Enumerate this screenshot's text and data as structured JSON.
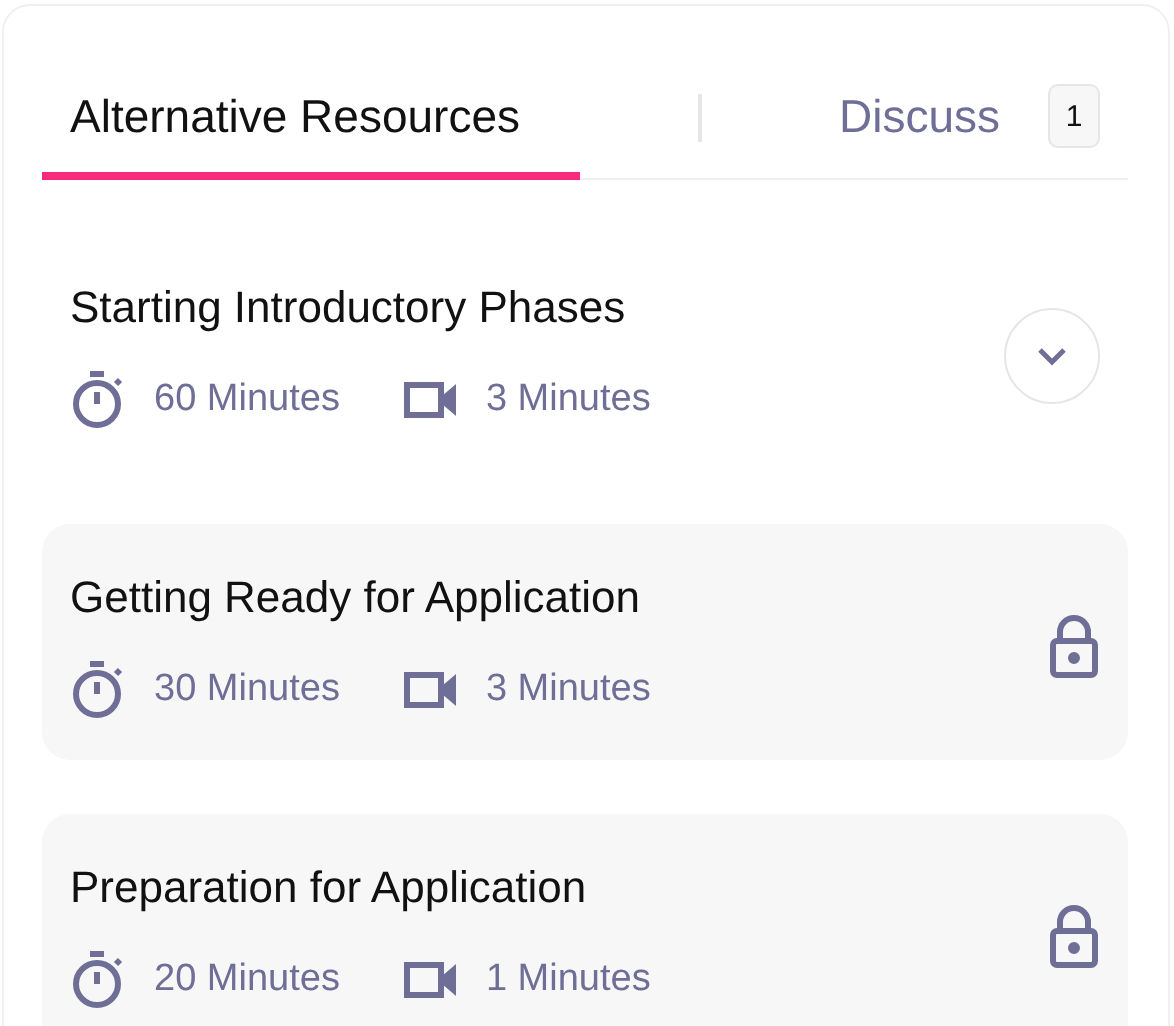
{
  "tabs": [
    {
      "label": "Alternative Resources",
      "selected": true
    },
    {
      "label": "Discuss",
      "selected": false,
      "badge": "1"
    }
  ],
  "lessons": [
    {
      "title": "Starting Introductory Phases",
      "duration": "60 Minutes",
      "video": "3 Minutes",
      "locked": false
    },
    {
      "title": "Getting Ready for Application",
      "duration": "30 Minutes",
      "video": "3 Minutes",
      "locked": true
    },
    {
      "title": "Preparation for Application",
      "duration": "20 Minutes",
      "video": "1 Minutes",
      "locked": true
    }
  ]
}
